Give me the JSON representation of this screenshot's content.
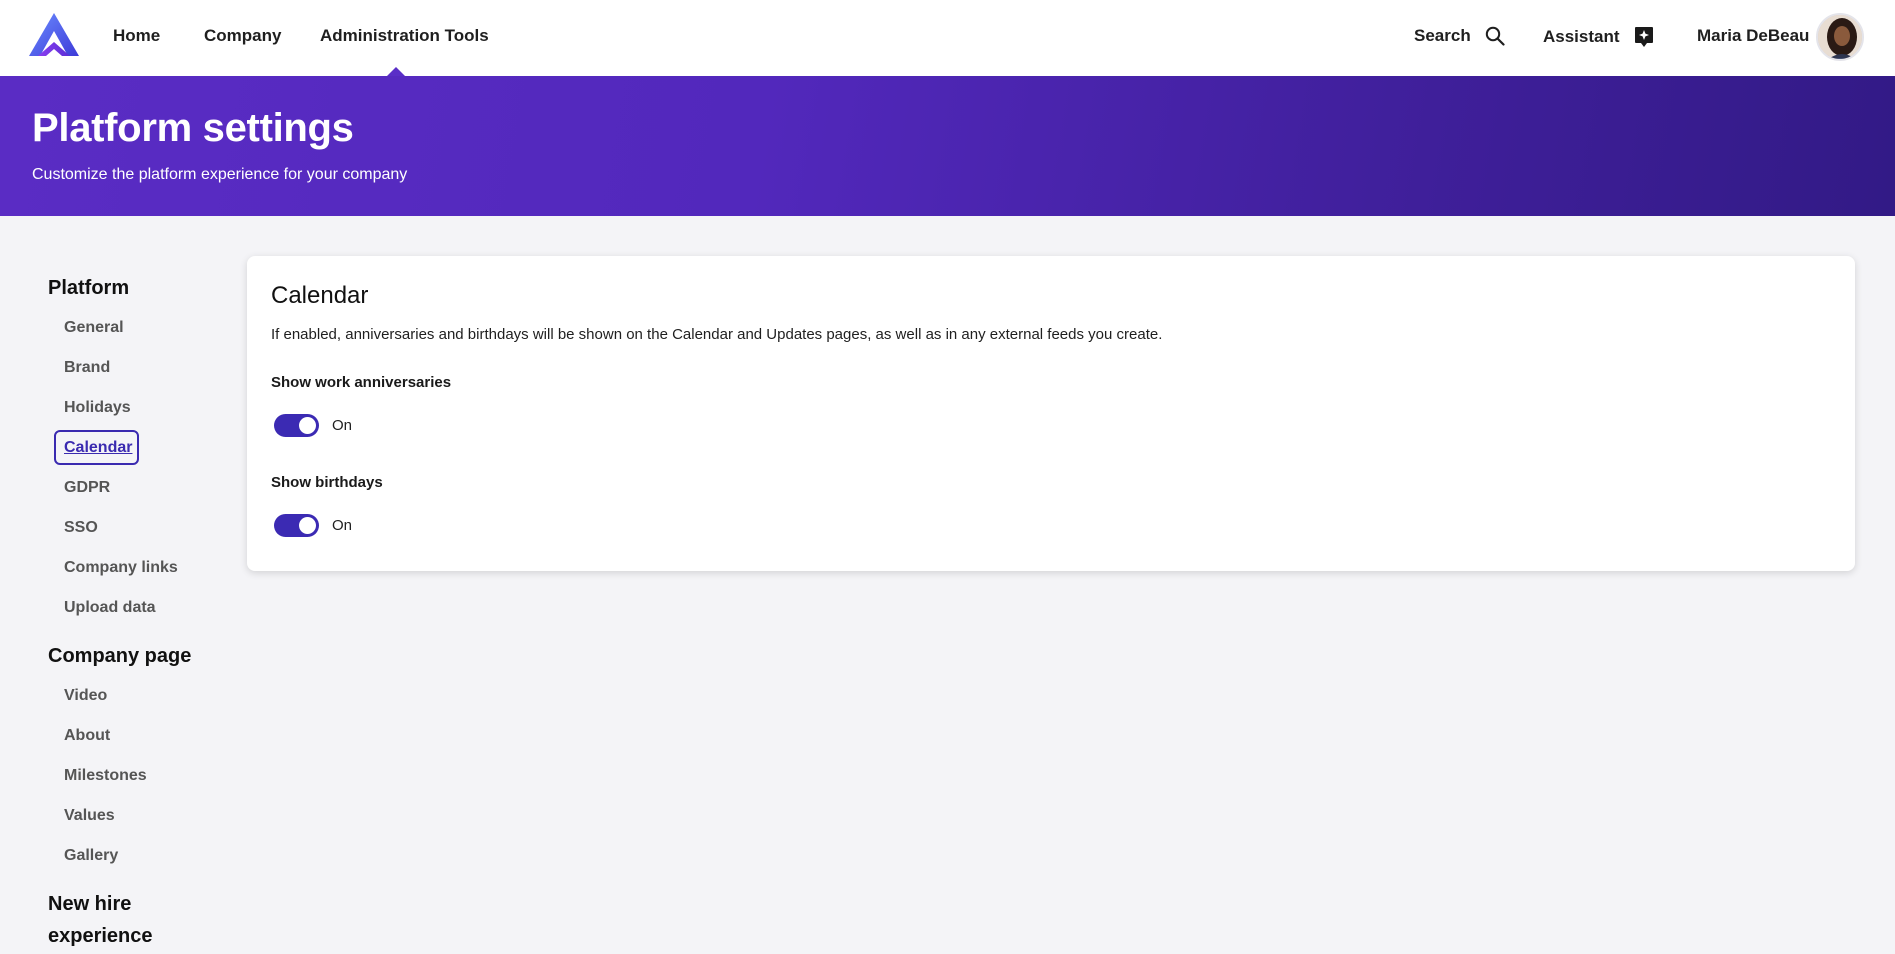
{
  "nav": {
    "home": "Home",
    "company": "Company",
    "admin_tools": "Administration Tools",
    "search": "Search",
    "assistant": "Assistant",
    "user_name": "Maria DeBeau"
  },
  "hero": {
    "title": "Platform settings",
    "subtitle": "Customize the platform experience for your company"
  },
  "sidebar": {
    "platform": {
      "title": "Platform",
      "items": [
        "General",
        "Brand",
        "Holidays",
        "Calendar",
        "GDPR",
        "SSO",
        "Company links",
        "Upload data"
      ]
    },
    "company_page": {
      "title": "Company page",
      "items": [
        "Video",
        "About",
        "Milestones",
        "Values",
        "Gallery"
      ]
    },
    "new_hire": {
      "title": "New hire experience"
    },
    "active_item": "Calendar"
  },
  "card": {
    "title": "Calendar",
    "description": "If enabled, anniversaries and birthdays will be shown on the Calendar and Updates pages, as well as in any external feeds you create.",
    "settings": [
      {
        "label": "Show work anniversaries",
        "state": "On"
      },
      {
        "label": "Show birthdays",
        "state": "On"
      }
    ]
  },
  "colors": {
    "accent": "#3b2ab3",
    "hero_start": "#5a2cc4",
    "hero_end": "#321a86"
  }
}
